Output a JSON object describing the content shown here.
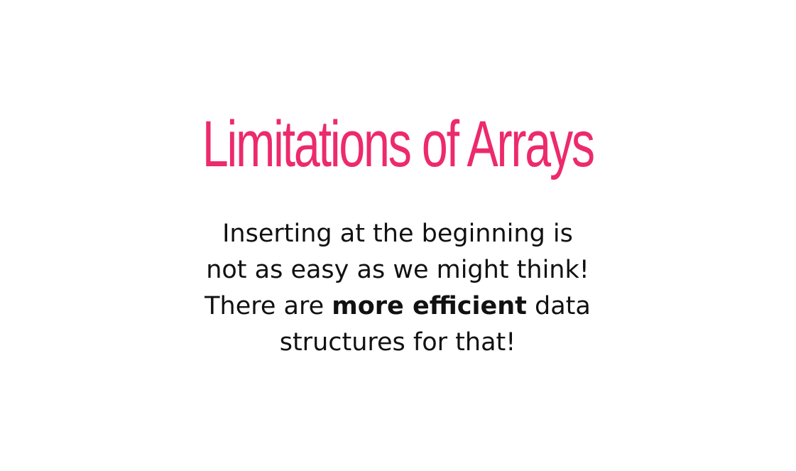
{
  "slide": {
    "title": "Limitations of Arrays",
    "title_color": "#ec2a6c",
    "body": {
      "line1": "Inserting at the beginning is",
      "line2": "not as easy as we might think!",
      "line3_before": "There are ",
      "line3_bold": "more efficient",
      "line3_after": " data",
      "line4": "structures for that!"
    }
  }
}
